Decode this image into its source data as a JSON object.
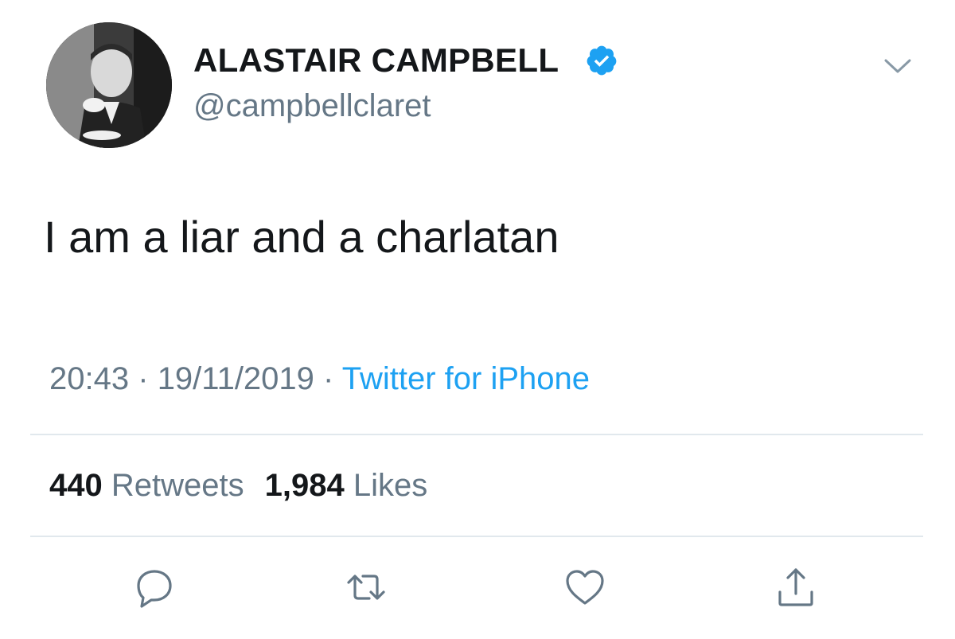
{
  "author": {
    "display_name": "ALASTAIR CAMPBELL",
    "handle": "@campbellclaret",
    "verified": true,
    "avatar_icon": "profile-photo"
  },
  "tweet": {
    "text": "I am a liar and a charlatan",
    "time": "20:43",
    "date": "19/11/2019",
    "separator": "·",
    "source": "Twitter for iPhone"
  },
  "stats": {
    "retweets_count": "440",
    "retweets_label": "Retweets",
    "likes_count": "1,984",
    "likes_label": "Likes"
  },
  "actions": {
    "reply_icon": "reply-icon",
    "retweet_icon": "retweet-icon",
    "like_icon": "heart-icon",
    "share_icon": "share-icon"
  },
  "colors": {
    "text": "#14171a",
    "secondary": "#657786",
    "link": "#1da1f2",
    "divider": "#e1e8ed",
    "verified": "#1da1f2"
  }
}
